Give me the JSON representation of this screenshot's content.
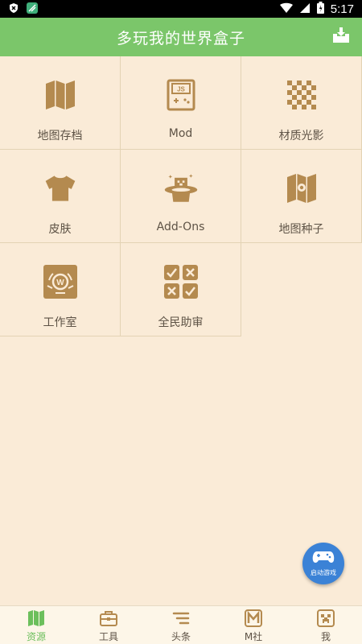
{
  "status_bar": {
    "time": "5:17"
  },
  "app_bar": {
    "title": "多玩我的世界盒子"
  },
  "grid": {
    "items": [
      {
        "label": "地图存档",
        "icon": "map-icon"
      },
      {
        "label": "Mod",
        "icon": "js-console-icon"
      },
      {
        "label": "材质光影",
        "icon": "checker-icon"
      },
      {
        "label": "皮肤",
        "icon": "shirt-icon"
      },
      {
        "label": "Add-Ons",
        "icon": "magic-hat-icon"
      },
      {
        "label": "地图种子",
        "icon": "map-seed-icon"
      },
      {
        "label": "工作室",
        "icon": "studio-icon"
      },
      {
        "label": "全民助审",
        "icon": "review-icon"
      }
    ]
  },
  "fab": {
    "label": "启动游戏"
  },
  "bottom_nav": {
    "items": [
      {
        "label": "资源",
        "icon": "map-icon",
        "active": true
      },
      {
        "label": "工具",
        "icon": "toolbox-icon",
        "active": false
      },
      {
        "label": "头条",
        "icon": "headlines-icon",
        "active": false
      },
      {
        "label": "M社",
        "icon": "m-community-icon",
        "active": false
      },
      {
        "label": "我",
        "icon": "creeper-icon",
        "active": false
      }
    ]
  },
  "colors": {
    "app_bar": "#7bc66a",
    "background": "#faebd7",
    "icon": "#b48a4f",
    "fab": "#3b82d6",
    "active_nav": "#6cbf5c"
  }
}
